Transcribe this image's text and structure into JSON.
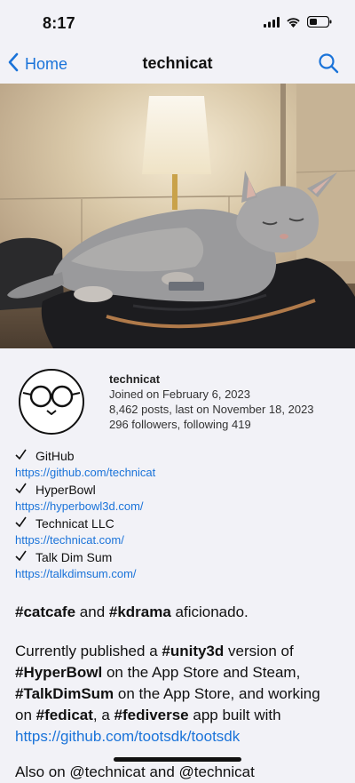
{
  "status": {
    "time": "8:17"
  },
  "nav": {
    "back_label": "Home",
    "title": "technicat"
  },
  "profile": {
    "name": "technicat",
    "joined": "Joined on February 6, 2023",
    "posts": "8,462 posts, last on November 18, 2023",
    "followers": "296 followers, following 419"
  },
  "links": [
    {
      "title": "GitHub",
      "url": "https://github.com/technicat"
    },
    {
      "title": "HyperBowl",
      "url": "https://hyperbowl3d.com/"
    },
    {
      "title": "Technicat LLC",
      "url": "https://technicat.com/"
    },
    {
      "title": "Talk Dim Sum",
      "url": "https://talkdimsum.com/"
    }
  ],
  "bio": {
    "p1": {
      "tag1": "#catcafe",
      "and": " and ",
      "tag2": "#kdrama",
      "rest": " aficionado."
    },
    "p2": {
      "t1": "Currently published a ",
      "tag_unity": "#unity3d",
      "t2": " version of",
      "tag_hyperbowl": "#HyperBowl",
      "t3": " on the App Store and Steam,",
      "tag_talkdimsum": "#TalkDimSum",
      "t4": " on the App Store, and working",
      "t5": "on ",
      "tag_fedicat": "#fedicat",
      "t6": ", a ",
      "tag_fediverse": "#fediverse",
      "t7": " app built with",
      "link": "https://github.com/tootsdk/tootsdk"
    },
    "p3": "Also on @technicat and @technicat"
  },
  "colors": {
    "accent": "#1a73d9",
    "background": "#f2f2f7"
  },
  "icons": [
    "back-chevron-icon",
    "search-icon",
    "signal-icon",
    "wifi-icon",
    "battery-icon",
    "check-icon"
  ]
}
